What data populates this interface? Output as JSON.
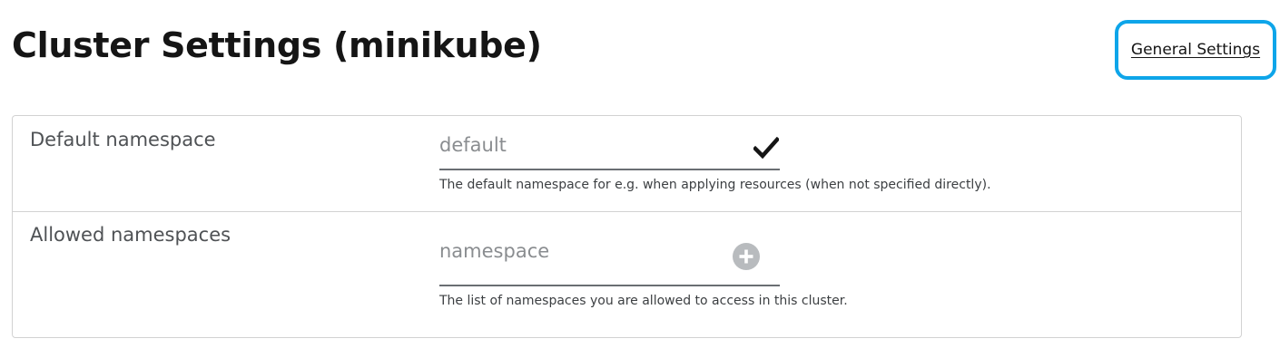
{
  "header": {
    "title": "Cluster Settings (minikube)",
    "general_settings_link": "General Settings"
  },
  "settings": {
    "default_namespace": {
      "label": "Default namespace",
      "placeholder": "default",
      "value": "",
      "status_icon": "check-icon",
      "helper": "The default namespace for e.g. when applying resources (when not specified directly)."
    },
    "allowed_namespaces": {
      "label": "Allowed namespaces",
      "placeholder": "namespace",
      "value": "",
      "add_icon": "plus-circle-icon",
      "helper": "The list of namespaces you are allowed to access in this cluster."
    }
  },
  "colors": {
    "focus_ring": "#0ea5e9",
    "text": "#151515",
    "label": "#4f5255",
    "border": "#d2d2d2"
  }
}
